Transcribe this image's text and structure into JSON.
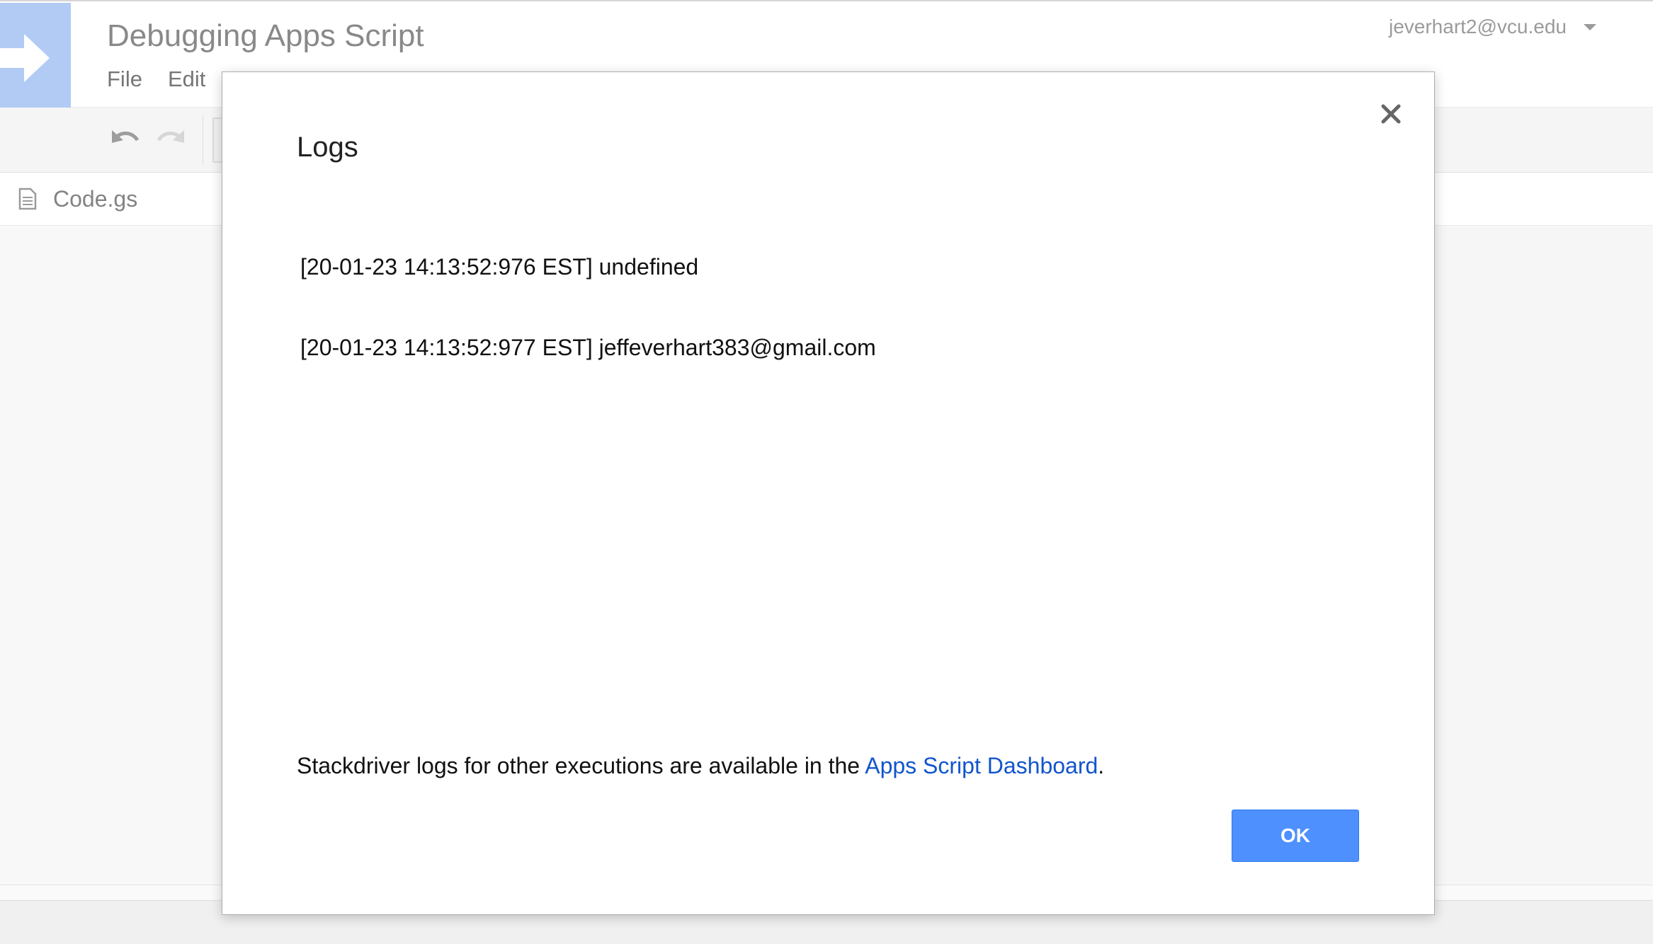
{
  "app": {
    "title": "Debugging Apps Script",
    "menu": [
      "File",
      "Edit"
    ],
    "account": "jeverhart2@vcu.edu",
    "files": [
      {
        "name": "Code.gs"
      }
    ]
  },
  "dialog": {
    "title": "Logs",
    "log_lines": [
      "[20-01-23 14:13:52:976 EST] undefined",
      "[20-01-23 14:13:52:977 EST] jeffeverhart383@gmail.com"
    ],
    "footer_text": "Stackdriver logs for other executions are available in the ",
    "footer_link": "Apps Script Dashboard",
    "footer_suffix": ".",
    "ok_label": "OK"
  },
  "colors": {
    "logo_bg": "#a4c2f4",
    "ok_button": "#4d90fe",
    "link": "#1155cc"
  },
  "icons": {
    "logo": "arrow-right-icon",
    "undo": "undo-icon",
    "redo": "redo-icon",
    "file": "document-icon",
    "close": "close-icon",
    "account_menu": "chevron-down-icon"
  }
}
